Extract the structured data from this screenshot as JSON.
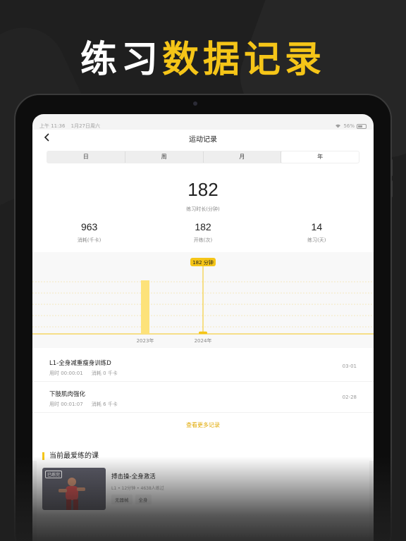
{
  "headline": {
    "part1": "练习",
    "part2": "数据记录"
  },
  "colors": {
    "accent": "#f5c518",
    "background": "#1f1f1f",
    "bar": "#fde27a"
  },
  "status_bar": {
    "time": "上午 11:36",
    "date": "1月27日周六",
    "battery": "56%",
    "icons": [
      "wifi-icon",
      "battery-icon"
    ]
  },
  "nav": {
    "back_icon": "chevron-left-icon",
    "title": "运动记录"
  },
  "segments": {
    "items": [
      "日",
      "周",
      "月",
      "年"
    ],
    "selected": "年"
  },
  "summary": {
    "total_value": "182",
    "total_label": "练习时长(分钟)",
    "stats": [
      {
        "value": "963",
        "label": "消耗(千卡)"
      },
      {
        "value": "182",
        "label": "开练(次)"
      },
      {
        "value": "14",
        "label": "练习(天)"
      }
    ]
  },
  "chart_data": {
    "type": "bar",
    "categories": [
      "2023年",
      "2024年"
    ],
    "values": [
      182,
      8
    ],
    "selected_index": 1,
    "tooltip": "182 分钟"
  },
  "records": [
    {
      "title": "L1-全身减重瘦身训练D",
      "duration": "用时 00:00:01",
      "calories": "消耗 0 千卡",
      "date": "03-01"
    },
    {
      "title": "下肢肌肉强化",
      "duration": "用时 00:01:07",
      "calories": "消耗 6 千卡",
      "date": "02-28"
    }
  ],
  "more_link": "查看更多记录",
  "favorite": {
    "section_title": "当前最爱练的课",
    "thumb_tag": "已练完",
    "course_title": "搏击操-全身激活",
    "meta": "L1 • 12分钟 • 4638人练过",
    "tags": [
      "无器械",
      "全身"
    ]
  }
}
